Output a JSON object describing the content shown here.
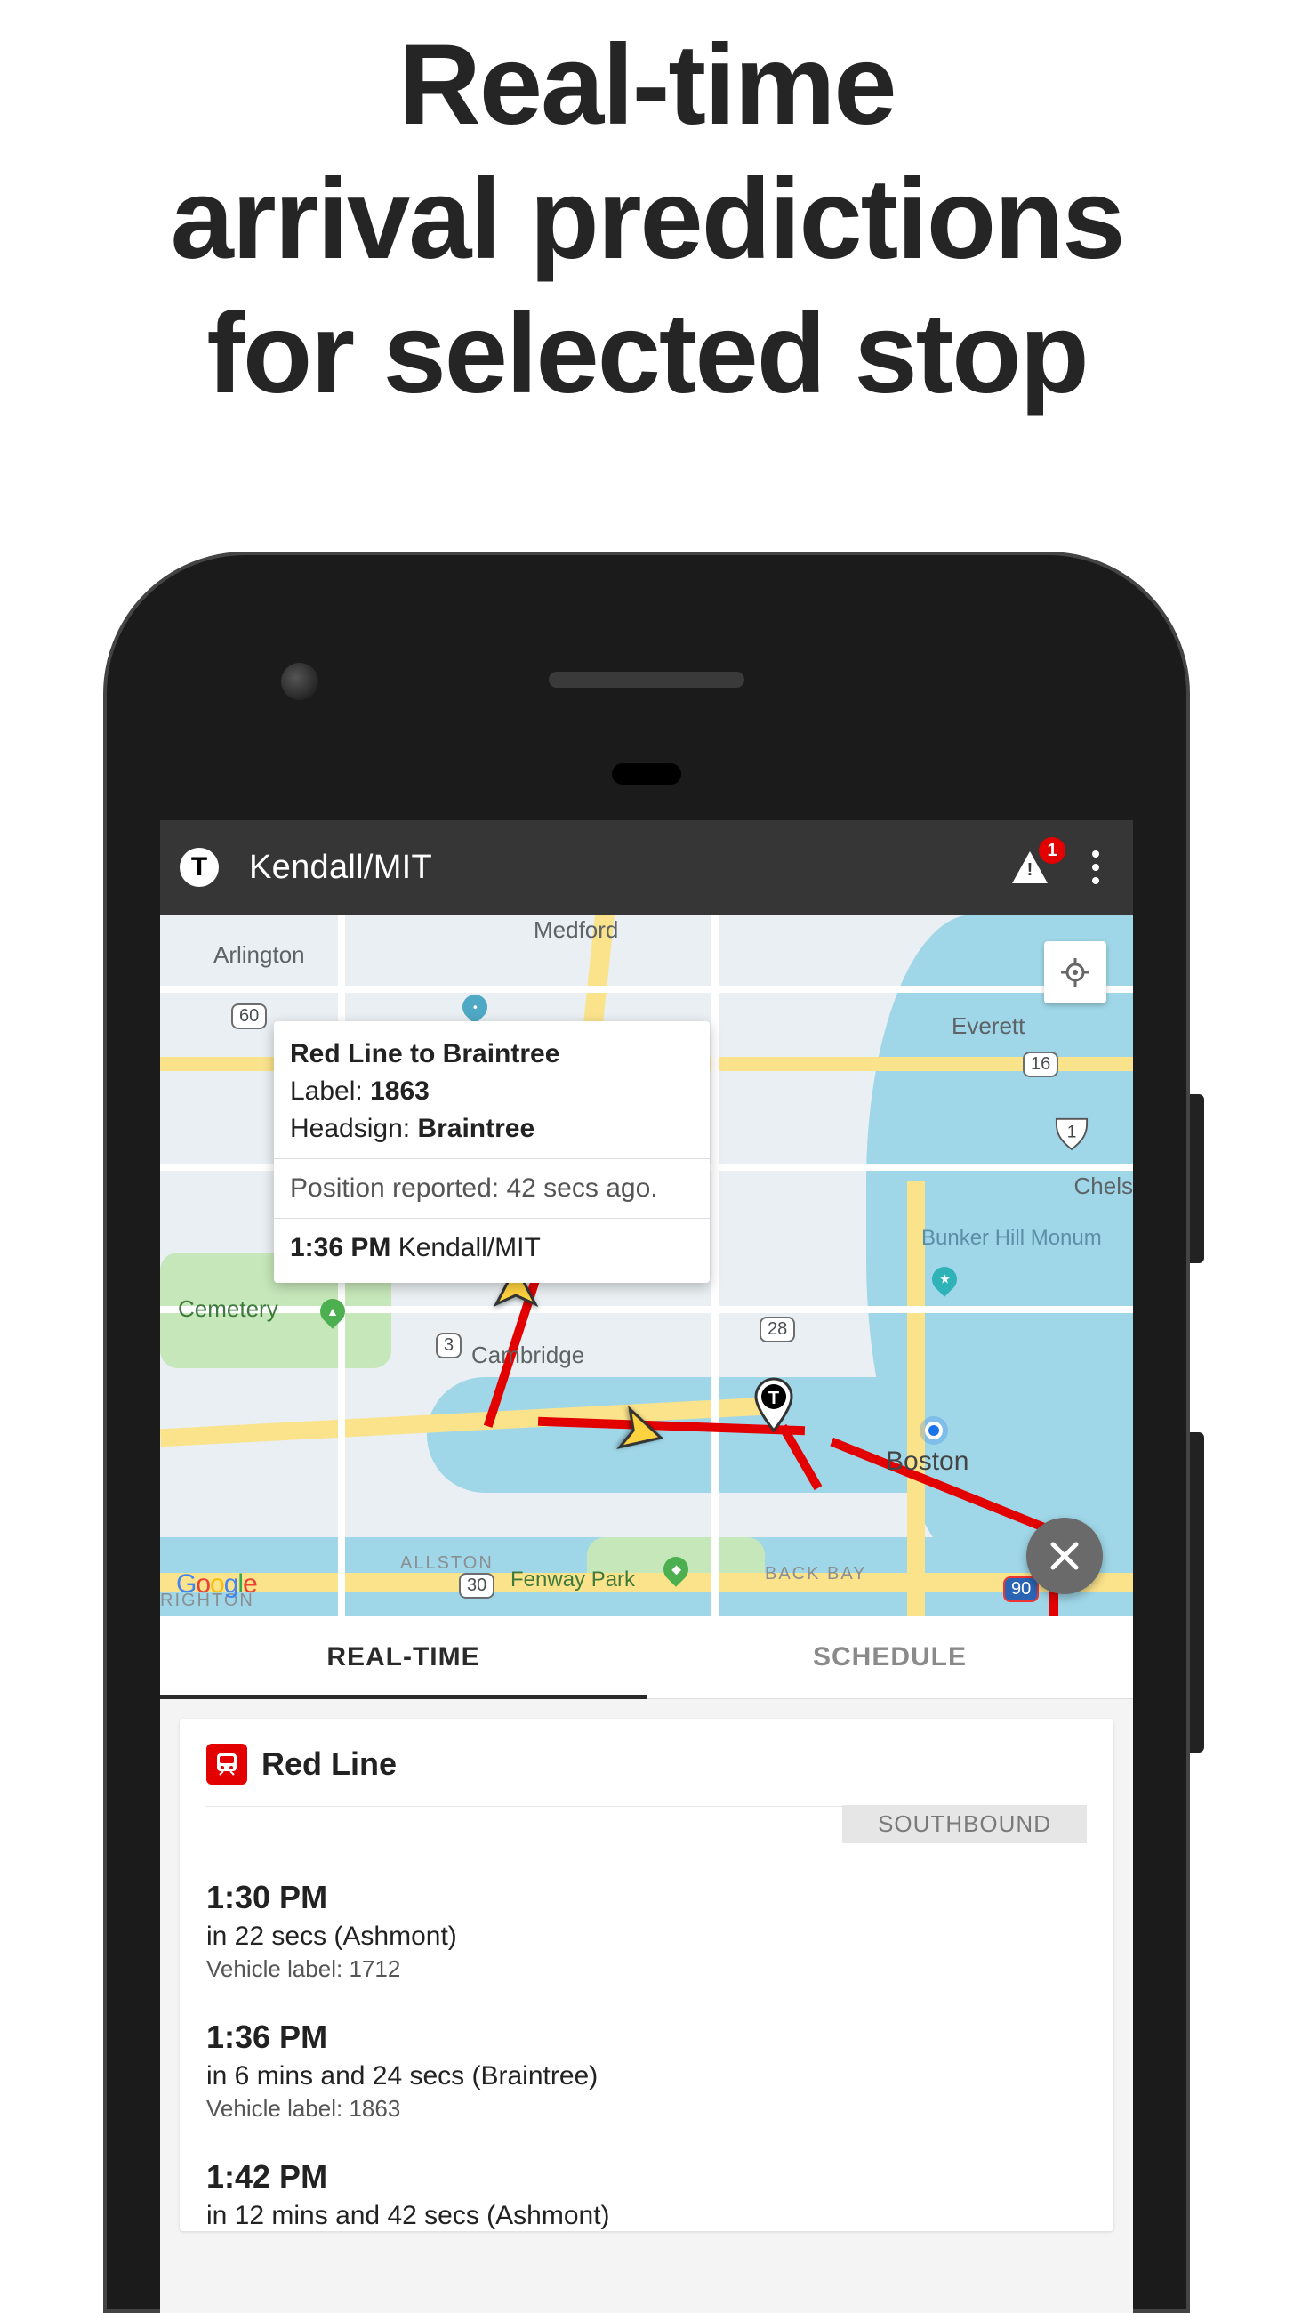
{
  "promo": {
    "line1": "Real-time",
    "line2": "arrival predictions",
    "line3": "for selected stop"
  },
  "appbar": {
    "title": "Kendall/MIT",
    "alerts_count": "1"
  },
  "map": {
    "labels": {
      "arlington": "Arlington",
      "medford": "Medford",
      "everett": "Everett",
      "chelsea": "Chels",
      "bunker": "Bunker Hill Monum",
      "cambridge": "Cambridge",
      "boston": "Boston",
      "allston": "ALLSTON",
      "backbay": "BACK BAY",
      "fenway": "Fenway Park",
      "brighton": "RIGHTON",
      "cemetery": "Cemetery"
    },
    "signs": {
      "r60": "60",
      "r3": "3",
      "r28": "28",
      "r16": "16",
      "r1": "1",
      "r30": "30",
      "r90": "90"
    },
    "infowindow": {
      "title": "Red Line to Braintree",
      "label_prefix": "Label: ",
      "label_value": "1863",
      "headsign_prefix": "Headsign: ",
      "headsign_value": "Braintree",
      "position": "Position reported: 42 secs ago.",
      "eta_time": "1:36 PM",
      "eta_stop": " Kendall/MIT"
    },
    "google": {
      "g": "G",
      "o1": "o",
      "o2": "o",
      "g2": "g",
      "l": "l",
      "e": "e"
    }
  },
  "tabs": {
    "realtime": "REAL-TIME",
    "schedule": "SCHEDULE"
  },
  "card": {
    "line_name": "Red Line",
    "direction": "SOUTHBOUND",
    "predictions": [
      {
        "time": "1:30 PM",
        "sub": "in 22 secs (Ashmont)",
        "veh": "Vehicle label: 1712"
      },
      {
        "time": "1:36 PM",
        "sub": "in 6 mins and 24 secs (Braintree)",
        "veh": "Vehicle label: 1863"
      },
      {
        "time": "1:42 PM",
        "sub": "in 12 mins and 42 secs (Ashmont)",
        "veh": ""
      }
    ]
  }
}
